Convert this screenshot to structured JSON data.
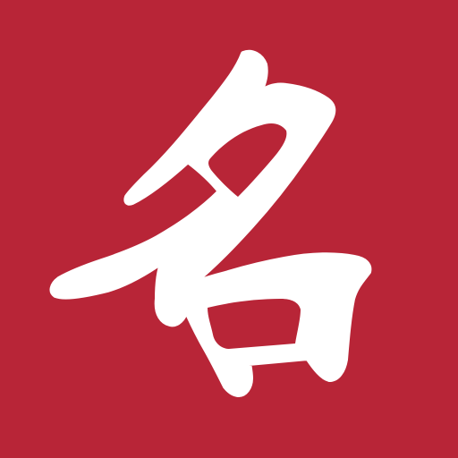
{
  "icon": {
    "character": "名",
    "background_color": "#b82537",
    "glyph_color": "#ffffff"
  }
}
